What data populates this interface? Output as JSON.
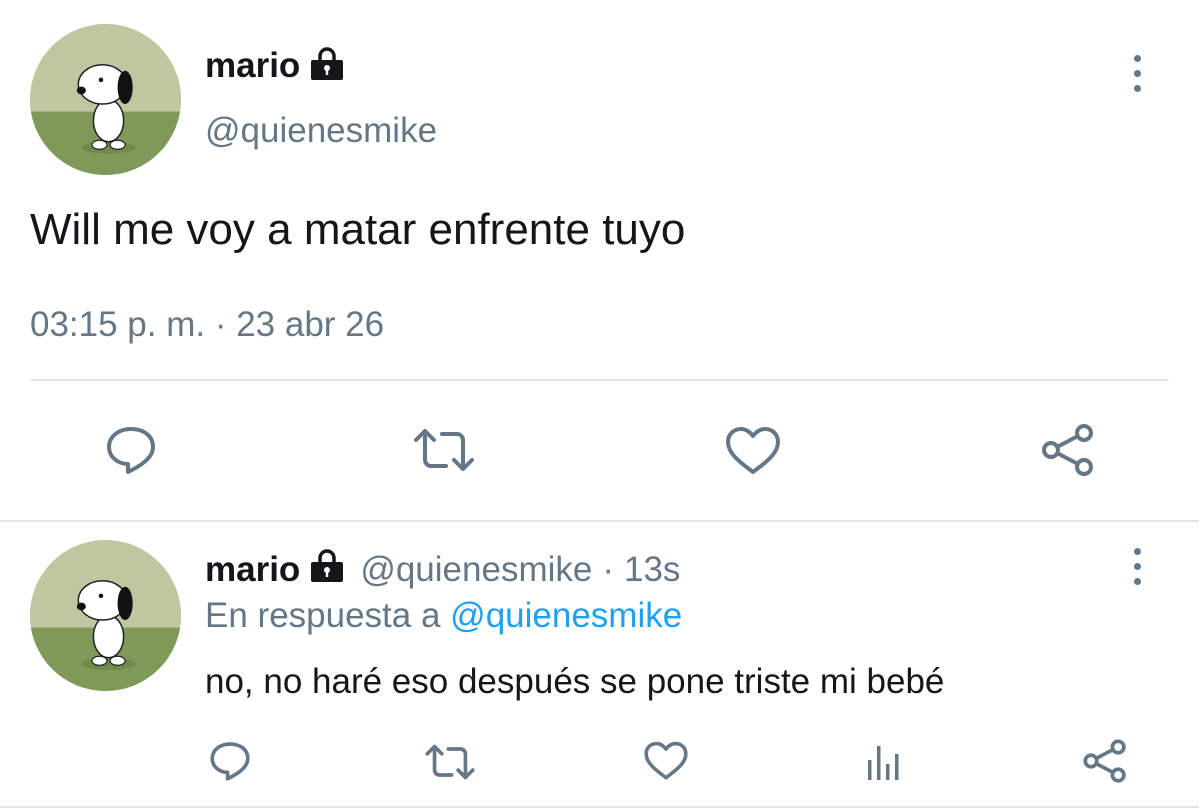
{
  "main_tweet": {
    "author_name": "mario",
    "author_handle": "@quienesmike",
    "text": "Will me voy a matar enfrente tuyo",
    "timestamp": "03:15 p. m. · 23 abr 26",
    "actions": [
      "reply-icon",
      "retweet-icon",
      "like-icon",
      "share-icon"
    ]
  },
  "reply_tweet": {
    "author_name": "mario",
    "author_handle": "@quienesmike",
    "separator": "·",
    "age": "13s",
    "in_reply_prefix": "En respuesta a",
    "in_reply_handle": "@quienesmike",
    "text": "no, no haré eso después se pone triste mi bebé",
    "actions": [
      "reply-icon",
      "retweet-icon",
      "like-icon",
      "analytics-icon",
      "share-icon"
    ]
  },
  "colors": {
    "text": "#14171a",
    "secondary": "#657786",
    "link": "#1da1f2",
    "divider": "#e1e8ed",
    "icon": "#657786"
  }
}
